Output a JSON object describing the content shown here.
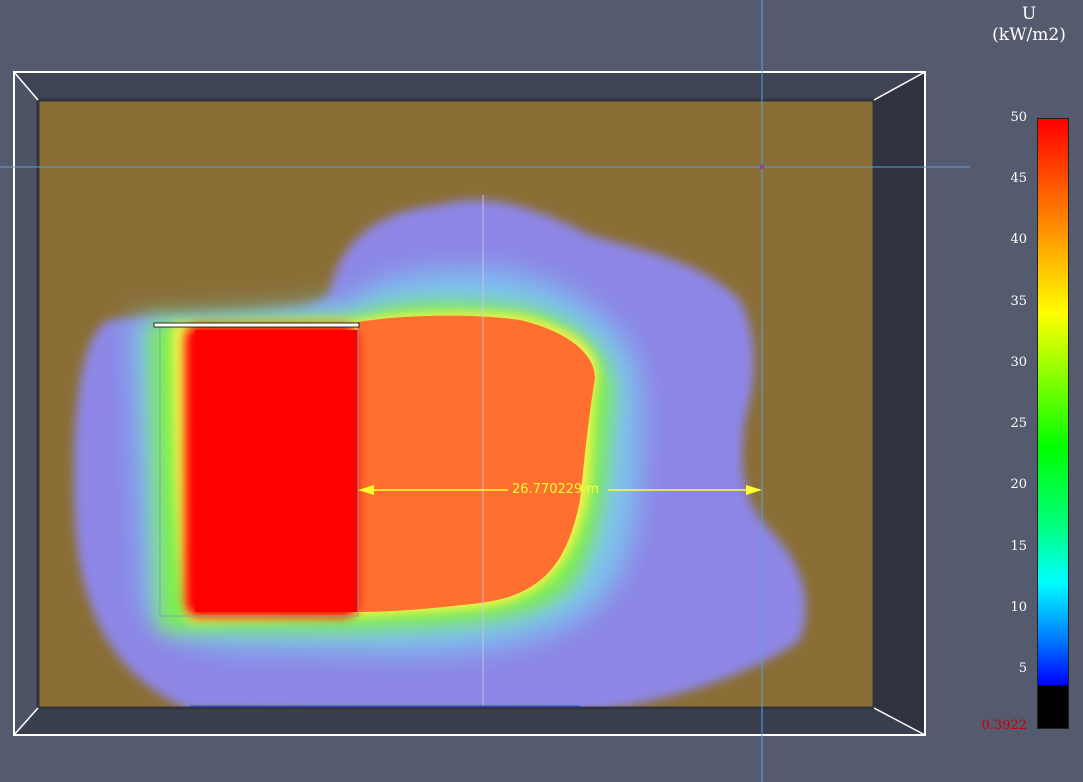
{
  "viewport": {
    "measurement_label": "26.770229 m",
    "colors": {
      "background": "#555b6e",
      "floor": "#8a6e35",
      "fire_core": "#ff0000",
      "hot_zone": "#ff6f30",
      "halo": "#8e86e8",
      "guide_line": "#5aa0e0",
      "measure_line": "#ffff30"
    }
  },
  "legend": {
    "quantity": "U",
    "unit": "(kW/m2)",
    "ticks": [
      "50",
      "45",
      "40",
      "35",
      "30",
      "25",
      "20",
      "15",
      "10",
      "5"
    ],
    "min_value": "0.3922",
    "colormap": [
      "#000000",
      "#0000ff",
      "#0080ff",
      "#00ffff",
      "#00ff00",
      "#ffff00",
      "#ff8000",
      "#ff0000"
    ]
  }
}
